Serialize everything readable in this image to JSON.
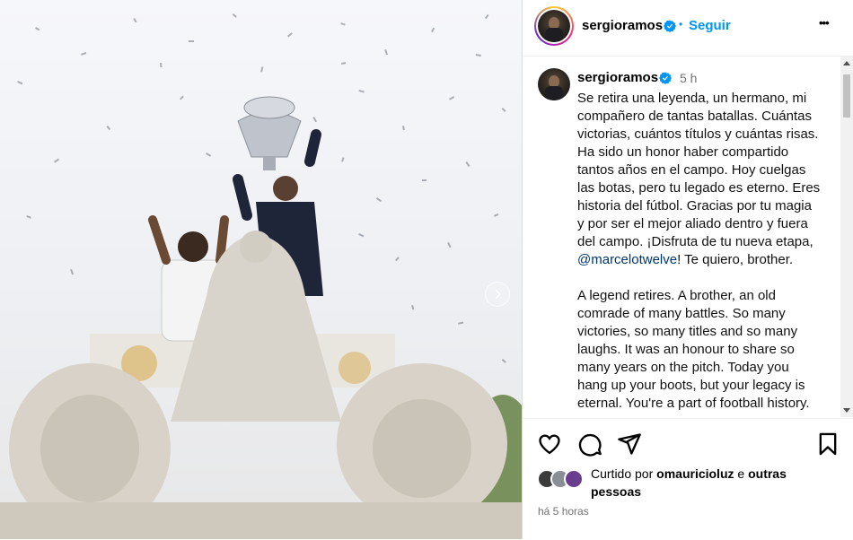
{
  "post": {
    "username": "sergioramos",
    "follow_label": "Seguir",
    "separator": "•",
    "more_label": "•••"
  },
  "caption": {
    "username": "sergioramos",
    "time_ago": "5 h",
    "text_part1": "Se retira una leyenda, un hermano, mi compañero de tantas batallas. Cuántas victorias, cuántos títulos y cuántas risas. Ha sido un honor haber compartido tantos años en el campo. Hoy cuelgas las botas, pero tu legado es eterno. Eres historia del fútbol. Gracias por tu magia y por ser el mejor aliado dentro y fuera del campo. ¡Disfruta de tu nueva etapa, ",
    "mention": "@marcelotwelve",
    "text_part2": "! Te quiero, brother.\n\nA legend retires. A brother, an old comrade of many battles. So many victories, so many titles and so many laughs. It was an honour to share so many years on the pitch. Today you hang up your boots, but your legacy is eternal. You're a part of football history."
  },
  "likes": {
    "prefix": "Curtido por",
    "liker": "omauricioluz",
    "suffix": "e",
    "others": "outras pessoas"
  },
  "timestamp": "há 5 horas",
  "icons": {
    "like": "heart-icon",
    "comment": "comment-icon",
    "share": "share-icon",
    "save": "bookmark-icon",
    "verified": "verified-badge-icon",
    "carousel_next": "chevron-right-icon"
  },
  "colors": {
    "accent": "#0095f6",
    "verified": "#0095f6",
    "mention": "#00376b",
    "muted": "#737373"
  }
}
